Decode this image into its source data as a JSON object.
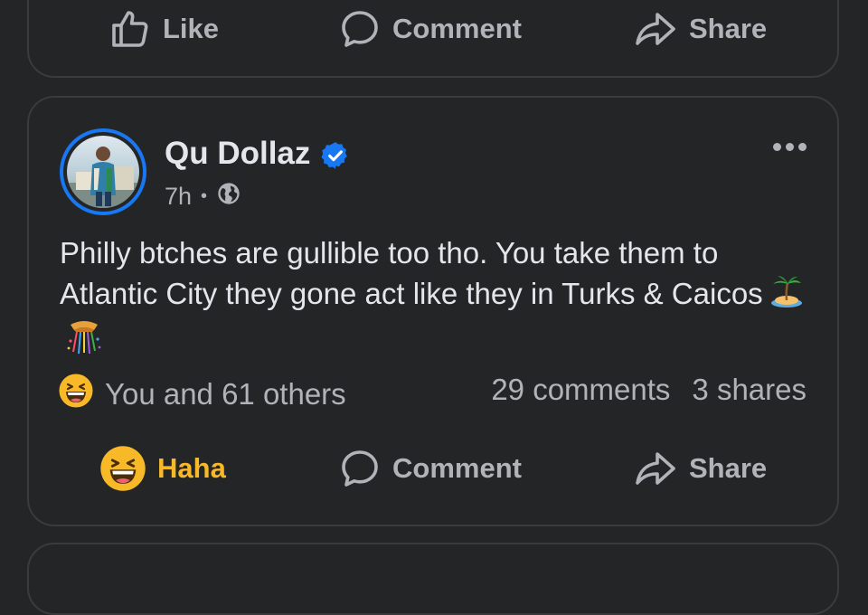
{
  "top_post": {
    "actions": {
      "like": "Like",
      "comment": "Comment",
      "share": "Share"
    }
  },
  "post": {
    "author": "Qu Dollaz",
    "verified": true,
    "time": "7h",
    "audience_icon": "globe-icon",
    "text": "Philly btches are gullible too tho. You take them to Atlantic City they gone act like they in Turks & Caicos",
    "text_emojis": [
      "desert-island-emoji",
      "confetti-ball-emoji"
    ],
    "reaction_icon": "laughing-face-emoji",
    "reaction_summary": "You and 61 others",
    "comments": "29 comments",
    "shares": "3 shares",
    "actions": {
      "reaction": "Haha",
      "comment": "Comment",
      "share": "Share"
    }
  },
  "colors": {
    "background": "#242526",
    "card_border": "#3a3b3c",
    "primary_text": "#e4e6eb",
    "secondary_text": "#b0b3b8",
    "verified_blue": "#1877f2",
    "haha_yellow": "#f7b928"
  }
}
